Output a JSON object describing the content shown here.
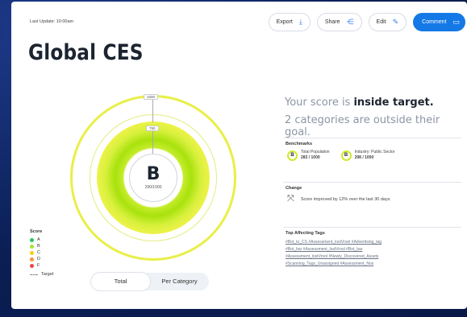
{
  "header": {
    "last_update": "Last Update: 10:00am",
    "title": "Global CES"
  },
  "toolbar": {
    "export_label": "Export",
    "share_label": "Share",
    "edit_label": "Edit",
    "comment_label": "Comment"
  },
  "score": {
    "grade": "B",
    "value_text": "290/1000",
    "max_tick": "1000",
    "mid_tick": "750",
    "progress_fraction": 0.29
  },
  "legend": {
    "title": "Score",
    "items": [
      {
        "label": "A",
        "color": "#22c55e"
      },
      {
        "label": "B",
        "color": "#a3e635"
      },
      {
        "label": "C",
        "color": "#facc15"
      },
      {
        "label": "D",
        "color": "#fb923c"
      },
      {
        "label": "F",
        "color": "#ef4444"
      }
    ],
    "target_label": "Target"
  },
  "view_toggle": {
    "total_label": "Total",
    "per_category_label": "Per Category",
    "active": "Total"
  },
  "summary": {
    "prefix": "Your score is ",
    "status": "inside target.",
    "subline": "2 categories are outside their goal."
  },
  "benchmarks": {
    "title": "Benchmarks",
    "items": [
      {
        "grade": "B",
        "name": "Total Population",
        "value": "283 / 1000"
      },
      {
        "grade": "B",
        "name": "Industry: Public Sector",
        "value": "298 / 1000"
      }
    ]
  },
  "change": {
    "title": "Change",
    "text": "Score improved by 12% over the last 30 days"
  },
  "tags": {
    "title": "Top Affecting Tags",
    "lines": [
      "#Bot_to_CS  #Assessment_lostVrool  #Advertising_tag",
      "#Bot_bar  #Assessment_lostVrool  #Bot_bar",
      "#Assessment_lostVrool  #Newly_Discovered_Assets",
      "#Scanning_Tags_Unassigned  #Assessment_Nos"
    ]
  },
  "colors": {
    "accent": "#1479e6",
    "score_ring": "#c5ec2a",
    "target_ring": "#e9ef48"
  }
}
